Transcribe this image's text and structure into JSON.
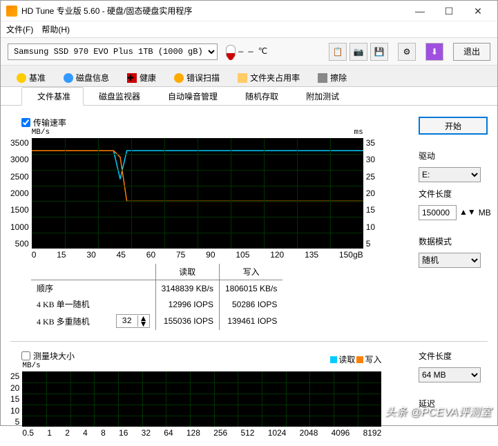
{
  "window": {
    "title": "HD Tune 专业版 5.60 - 硬盘/固态硬盘实用程序"
  },
  "menu": {
    "file": "文件(F)",
    "help": "帮助(H)"
  },
  "toolbar": {
    "device": "Samsung SSD 970 EVO Plus 1TB (1000 gB)",
    "temp": "— — ℃",
    "exit": "退出"
  },
  "tabs1": {
    "benchmark": "基准",
    "diskinfo": "磁盘信息",
    "health": "健康",
    "errorscan": "错误扫描",
    "folderusage": "文件夹占用率",
    "erase": "擦除"
  },
  "tabs2": {
    "filebm": "文件基准",
    "diskmon": "磁盘监视器",
    "aam": "自动噪音管理",
    "random": "随机存取",
    "extra": "附加测试"
  },
  "upper": {
    "chk_label": "传输速率",
    "y_unit": "MB/s",
    "y2_unit": "ms",
    "y_ticks": [
      "3500",
      "3000",
      "2500",
      "2000",
      "1500",
      "1000",
      "500"
    ],
    "y2_ticks": [
      "35",
      "30",
      "25",
      "20",
      "15",
      "10",
      "5"
    ],
    "x_ticks": [
      "0",
      "15",
      "30",
      "45",
      "60",
      "75",
      "90",
      "105",
      "120",
      "135",
      "150gB"
    ],
    "tbl": {
      "read": "读取",
      "write": "写入",
      "r1_lab": "顺序",
      "r1_r": "3148839 KB/s",
      "r1_w": "1806015 KB/s",
      "r2_lab": "4 KB 单一随机",
      "r2_r": "12996 IOPS",
      "r2_w": "50286 IOPS",
      "r3_lab": "4 KB 多重随机",
      "r3_spin": "32",
      "r3_r": "155036 IOPS",
      "r3_w": "139461 IOPS"
    }
  },
  "side": {
    "start": "开始",
    "drive_lbl": "驱动",
    "drive_val": "E:",
    "flen_lbl": "文件长度",
    "flen_val": "150000",
    "flen_unit": "MB",
    "mode_lbl": "数据模式",
    "mode_val": "随机"
  },
  "lower": {
    "chk_label": "测量块大小",
    "y_unit": "MB/s",
    "y_ticks": [
      "25",
      "20",
      "15",
      "10",
      "5"
    ],
    "x_ticks": [
      "0.5",
      "1",
      "2",
      "4",
      "8",
      "16",
      "32",
      "64",
      "128",
      "256",
      "512",
      "1024",
      "2048",
      "4096",
      "8192"
    ],
    "legend": {
      "read": "读取",
      "write": "写入"
    }
  },
  "side2": {
    "flen_lbl": "文件长度",
    "flen_val": "64 MB",
    "delay_lbl": "延迟"
  },
  "colors": {
    "read": "#00ccff",
    "write": "#ff8000"
  },
  "chart_data": {
    "type": "line",
    "title": "传输速率",
    "xlabel": "gB",
    "ylabel": "MB/s",
    "ylim": [
      0,
      3500
    ],
    "y2lim": [
      0,
      35
    ],
    "x": [
      0,
      15,
      30,
      37,
      40,
      43,
      45,
      60,
      75,
      90,
      105,
      120,
      135,
      150
    ],
    "series": [
      {
        "name": "读取",
        "values": [
          3100,
          3100,
          3100,
          3100,
          2200,
          3100,
          3100,
          3100,
          3100,
          3100,
          3100,
          3100,
          3100,
          3100
        ]
      },
      {
        "name": "写入",
        "values": [
          3100,
          3100,
          3100,
          3100,
          2900,
          1500,
          1500,
          1500,
          1500,
          1500,
          1500,
          1500,
          1500,
          1500
        ]
      }
    ]
  },
  "watermark": "头条 @PCEVA评测室"
}
